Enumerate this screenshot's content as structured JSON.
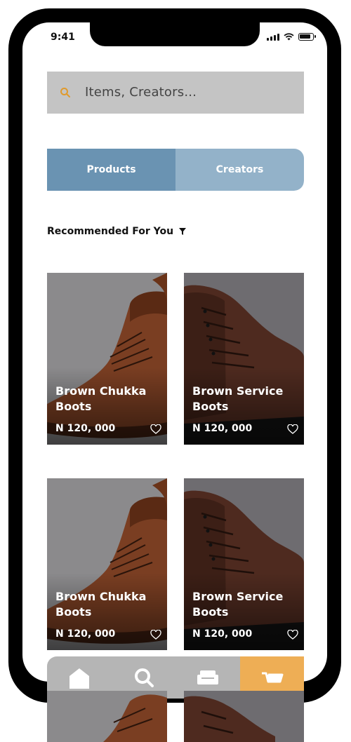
{
  "status_bar": {
    "time": "9:41"
  },
  "search": {
    "placeholder": "Items, Creators..."
  },
  "tabs": [
    {
      "label": "Products",
      "active": true
    },
    {
      "label": "Creators",
      "active": false
    }
  ],
  "section": {
    "title": "Recommended For You"
  },
  "products": [
    {
      "name": "Brown Chukka Boots",
      "price": "N 120, 000",
      "style": "chukka"
    },
    {
      "name": "Brown Service Boots",
      "price": "N 120, 000",
      "style": "service"
    },
    {
      "name": "Brown Chukka Boots",
      "price": "N 120, 000",
      "style": "chukka"
    },
    {
      "name": "Brown Service Boots",
      "price": "N 120, 000",
      "style": "service"
    }
  ],
  "bottom_nav": [
    {
      "icon": "home-icon"
    },
    {
      "icon": "search-icon"
    },
    {
      "icon": "sofa-icon"
    },
    {
      "icon": "cart-icon"
    }
  ],
  "colors": {
    "tab_active": "#6a93b2",
    "tab_inactive": "#93b2c9",
    "search_bg": "#c4c4c4",
    "accent": "#eeae55",
    "search_icon": "#e09a2c"
  }
}
